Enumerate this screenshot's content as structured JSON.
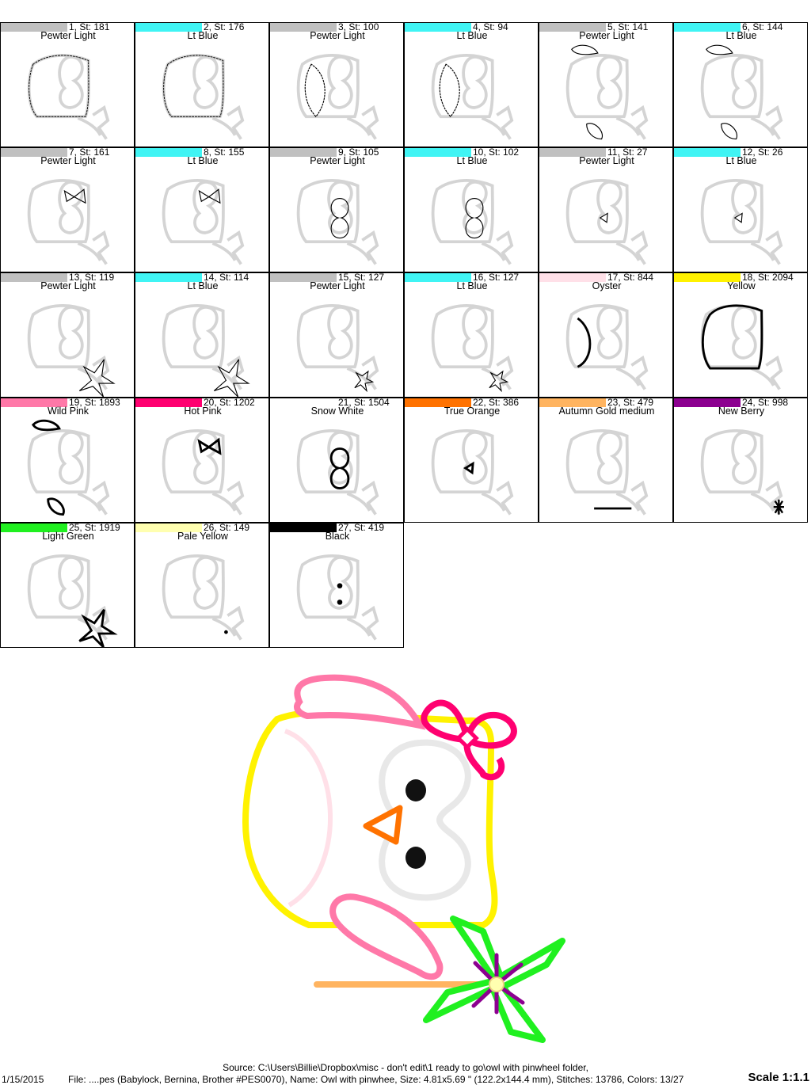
{
  "color_blocks": [
    {
      "number": "1",
      "stitches": "181",
      "label": "1, St: 181",
      "name": "Pewter Light",
      "color": "#c0c0c0",
      "part": "body"
    },
    {
      "number": "2",
      "stitches": "176",
      "label": "2, St: 176",
      "name": "Lt Blue",
      "color": "#40f4f4",
      "part": "body"
    },
    {
      "number": "3",
      "stitches": "100",
      "label": "3, St: 100",
      "name": "Pewter Light",
      "color": "#c0c0c0",
      "part": "belly"
    },
    {
      "number": "4",
      "stitches": "94",
      "label": "4, St: 94",
      "name": "Lt Blue",
      "color": "#40f4f4",
      "part": "belly"
    },
    {
      "number": "5",
      "stitches": "141",
      "label": "5, St: 141",
      "name": "Pewter Light",
      "color": "#c0c0c0",
      "part": "wings"
    },
    {
      "number": "6",
      "stitches": "144",
      "label": "6, St: 144",
      "name": "Lt Blue",
      "color": "#40f4f4",
      "part": "wings"
    },
    {
      "number": "7",
      "stitches": "161",
      "label": "7, St: 161",
      "name": "Pewter Light",
      "color": "#c0c0c0",
      "part": "bow"
    },
    {
      "number": "8",
      "stitches": "155",
      "label": "8, St: 155",
      "name": "Lt Blue",
      "color": "#40f4f4",
      "part": "bow"
    },
    {
      "number": "9",
      "stitches": "105",
      "label": "9, St: 105",
      "name": "Pewter Light",
      "color": "#c0c0c0",
      "part": "eyes"
    },
    {
      "number": "10",
      "stitches": "102",
      "label": "10, St: 102",
      "name": "Lt Blue",
      "color": "#40f4f4",
      "part": "eyes"
    },
    {
      "number": "11",
      "stitches": "27",
      "label": "11, St: 27",
      "name": "Pewter Light",
      "color": "#c0c0c0",
      "part": "beak"
    },
    {
      "number": "12",
      "stitches": "26",
      "label": "12, St: 26",
      "name": "Lt Blue",
      "color": "#40f4f4",
      "part": "beak"
    },
    {
      "number": "13",
      "stitches": "119",
      "label": "13, St: 119",
      "name": "Pewter Light",
      "color": "#c0c0c0",
      "part": "pinwheel"
    },
    {
      "number": "14",
      "stitches": "114",
      "label": "14, St: 114",
      "name": "Lt Blue",
      "color": "#40f4f4",
      "part": "pinwheel"
    },
    {
      "number": "15",
      "stitches": "127",
      "label": "15, St: 127",
      "name": "Pewter Light",
      "color": "#c0c0c0",
      "part": "pinwheel-small"
    },
    {
      "number": "16",
      "stitches": "127",
      "label": "16, St: 127",
      "name": "Lt Blue",
      "color": "#40f4f4",
      "part": "pinwheel-small"
    },
    {
      "number": "17",
      "stitches": "844",
      "label": "17, St: 844",
      "name": "Oyster",
      "color": "#ffe0e8",
      "part": "belly-arc"
    },
    {
      "number": "18",
      "stitches": "2094",
      "label": "18, St: 2094",
      "name": "Yellow",
      "color": "#fff200",
      "part": "outline"
    },
    {
      "number": "19",
      "stitches": "1893",
      "label": "19, St: 1893",
      "name": "Wild Pink",
      "color": "#ff78a8",
      "part": "wings-bold"
    },
    {
      "number": "20",
      "stitches": "1202",
      "label": "20, St: 1202",
      "name": "Hot Pink",
      "color": "#ff0070",
      "part": "bow-bold"
    },
    {
      "number": "21",
      "stitches": "1504",
      "label": "21, St: 1504",
      "name": "Snow White",
      "color": "#ffffff",
      "part": "eyes-bold"
    },
    {
      "number": "22",
      "stitches": "386",
      "label": "22, St: 386",
      "name": "True Orange",
      "color": "#ff7200",
      "part": "beak-bold"
    },
    {
      "number": "23",
      "stitches": "479",
      "label": "23, St: 479",
      "name": "Autumn Gold medium",
      "color": "#ffb460",
      "part": "stick"
    },
    {
      "number": "24",
      "stitches": "998",
      "label": "24, St: 998",
      "name": "New Berry",
      "color": "#8c0090",
      "part": "star"
    },
    {
      "number": "25",
      "stitches": "1919",
      "label": "25, St: 1919",
      "name": "Light Green",
      "color": "#20f020",
      "part": "pinwheel-bold"
    },
    {
      "number": "26",
      "stitches": "149",
      "label": "26, St: 149",
      "name": "Pale Yellow",
      "color": "#ffffb0",
      "part": "dot"
    },
    {
      "number": "27",
      "stitches": "419",
      "label": "27, St: 419",
      "name": "Black",
      "color": "#000000",
      "part": "pupils"
    }
  ],
  "footer": {
    "source": "Source: C:\\Users\\Billie\\Dropbox\\misc - don't edit\\1 ready to go\\owl with pinwheel folder,",
    "date": "1/15/2015",
    "file_info": "File: ....pes (Babylock, Bernina, Brother #PES0070), Name: Owl with pinwhee, Size: 4.81x5.69 \" (122.2x144.4 mm), Stitches: 13786, Colors: 13/27",
    "scale": "Scale 1:1.1"
  }
}
